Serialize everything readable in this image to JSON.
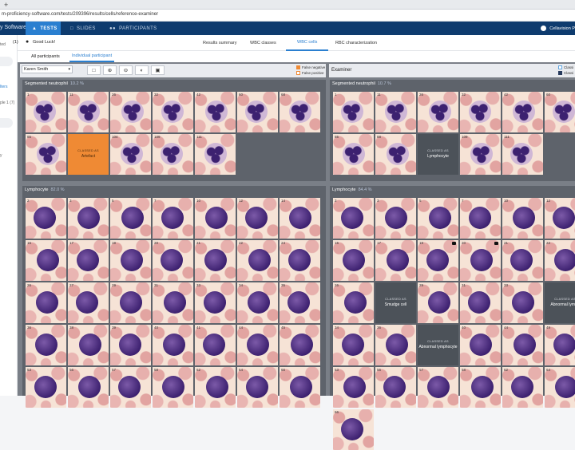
{
  "browser": {
    "new_tab_icon": "plus-icon",
    "url": "m-proficiency-software.com/tests/209396/results/cells/reference-examiner"
  },
  "nav": {
    "brand": "y Software",
    "tabs": [
      {
        "label": "TESTS",
        "icon": "graduation-cap-icon"
      },
      {
        "label": "SLIDES",
        "icon": "slides-icon"
      },
      {
        "label": "PARTICIPANTS",
        "icon": "people-icon"
      }
    ],
    "user": "Cellavision P"
  },
  "sidebar": {
    "texts": [
      "ted",
      "lters",
      "ple 1 (7)",
      "y"
    ]
  },
  "info": {
    "count": "(1)",
    "good_luck": "Good Luck!"
  },
  "result_tabs": [
    "Results summary",
    "WBC classes",
    "WBC cells",
    "RBC characterization"
  ],
  "subtabs": [
    "All participants",
    "Individual participant"
  ],
  "controls": {
    "participant": "Karen Smith",
    "tools": [
      "comment-icon",
      "zoom-in-icon",
      "zoom-out-icon",
      "contrast-icon",
      "fit-icon"
    ],
    "legend_left": [
      "False negative",
      "False positive"
    ],
    "legend_right": [
      "Classi",
      "Classi"
    ],
    "examiner": "Examiner",
    "colors": {
      "false_negative": "#ef8a34",
      "false_positive": "#f2a863",
      "classed": "#4c5259",
      "accent": "#2a7fd0"
    }
  },
  "panels": {
    "seg_left": {
      "title": "Segmented neutrophil",
      "pct": "10.2 %",
      "nums": [
        "1",
        "11",
        "26",
        "32",
        "42",
        "60",
        "68",
        "85",
        "",
        "104",
        "109",
        "111"
      ]
    },
    "seg_right": {
      "title": "Segmented neutrophil",
      "pct": "10.7 %",
      "nums": [
        "1",
        "11",
        "26",
        "32",
        "42",
        "60",
        "85",
        "88",
        "",
        "109",
        "111"
      ]
    },
    "lym_left": {
      "title": "Lymphocyte",
      "pct": "82.0 %",
      "nums": [
        "2",
        "3",
        "5",
        "7",
        "10",
        "12",
        "14",
        "15",
        "17",
        "19",
        "20",
        "21",
        "22",
        "24",
        "26",
        "27",
        "29",
        "31",
        "33",
        "34",
        "35",
        "36",
        "38",
        "39",
        "40",
        "41",
        "44",
        "45",
        "53",
        "56",
        "57",
        "58",
        "62",
        "64",
        "66"
      ]
    },
    "lym_right": {
      "title": "Lymphocyte",
      "pct": "84.4 %",
      "nums": [
        "2",
        "3",
        "5",
        "7",
        "10",
        "12",
        "15",
        "17",
        "19",
        "20",
        "21",
        "22",
        "26",
        "",
        "29",
        "31",
        "33",
        "",
        "34",
        "36",
        "",
        "40",
        "44",
        "49",
        "53",
        "56",
        "57",
        "58",
        "62",
        "64",
        "66"
      ]
    }
  },
  "classed": {
    "label": "CLASSED AS",
    "seg_left": "Artefact",
    "seg_right": "Lymphocyte",
    "lym_right_a": "Smudge cell",
    "lym_right_b": "Abnormal lymph",
    "lym_right_c": "Abnormal lymphocyte"
  }
}
